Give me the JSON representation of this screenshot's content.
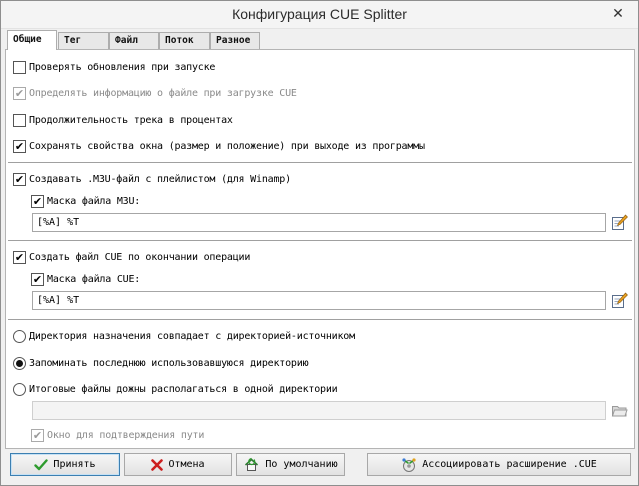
{
  "window": {
    "title": "Конфигурация CUE Splitter",
    "close_glyph": "✕"
  },
  "tabs": [
    {
      "label": "Общие",
      "active": true
    },
    {
      "label": "Тег",
      "active": false
    },
    {
      "label": "Файл",
      "active": false
    },
    {
      "label": "Поток",
      "active": false
    },
    {
      "label": "Разное",
      "active": false
    }
  ],
  "general": {
    "check_updates": {
      "label": "Проверять обновления при запуске",
      "checked": false,
      "enabled": true
    },
    "detect_file_info": {
      "label": "Определять информацию о файле при загрузке CUE",
      "checked": true,
      "enabled": false
    },
    "track_duration_percent": {
      "label": "Продолжительность трека в процентах",
      "checked": false,
      "enabled": true
    },
    "save_window_props": {
      "label": "Сохранять свойства окна (размер и положение) при выходе из программы",
      "checked": true,
      "enabled": true
    }
  },
  "m3u": {
    "create": {
      "label": "Создавать .M3U-файл с плейлистом (для Winamp)",
      "checked": true
    },
    "mask_enabled": {
      "label": "Маска файла M3U:",
      "checked": true
    },
    "mask_value": "[%A] %T"
  },
  "cue": {
    "create": {
      "label": "Создать файл CUE по окончании операции",
      "checked": true
    },
    "mask_enabled": {
      "label": "Маска файла CUE:",
      "checked": true
    },
    "mask_value": "[%A] %T"
  },
  "destination": {
    "options": [
      {
        "label": "Директория назначения совпадает с директорией-источником",
        "selected": false
      },
      {
        "label": "Запоминать последнюю использовавшуюся директорию",
        "selected": true
      },
      {
        "label": "Итоговые файлы дожны располагаться в одной директории",
        "selected": false
      }
    ],
    "path_value": "",
    "confirm_path": {
      "label": "Окно для подтверждения пути",
      "checked": true,
      "enabled": false
    }
  },
  "buttons": {
    "ok": "Принять",
    "cancel": "Отмена",
    "defaults": "По умолчанию",
    "associate": "Ассоциировать расширение .CUE"
  },
  "colors": {
    "accent_green": "#2e9b2e",
    "cancel_red": "#cc1f1f",
    "primary_border": "#3c7fb1"
  }
}
